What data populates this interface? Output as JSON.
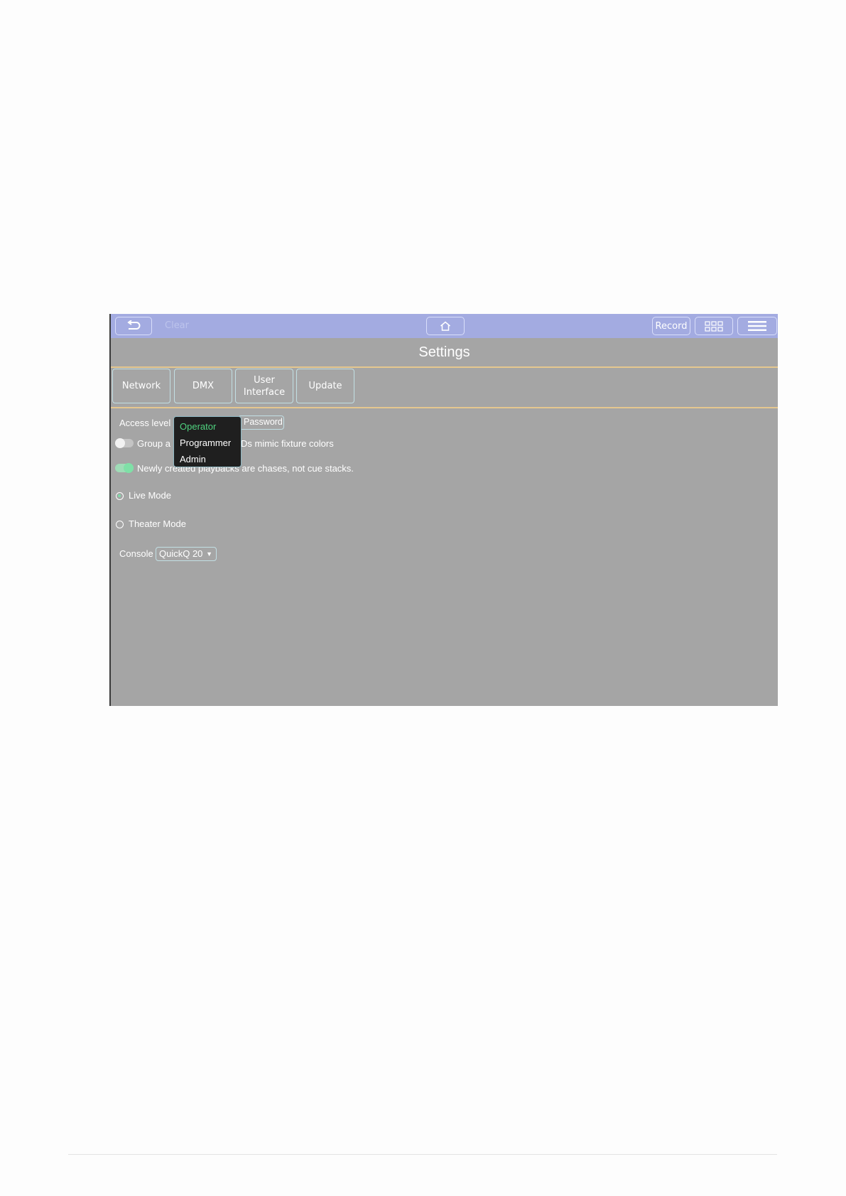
{
  "toolbar": {
    "clear_label": "Clear",
    "record_label": "Record"
  },
  "page": {
    "title": "Settings"
  },
  "tabs": [
    {
      "label": "Network"
    },
    {
      "label": "DMX"
    },
    {
      "label": "User Interface"
    },
    {
      "label": "Update"
    }
  ],
  "access": {
    "label": "Access level",
    "password_label": "Password",
    "options": [
      "Operator",
      "Programmer",
      "Admin"
    ],
    "selected": "Operator"
  },
  "options": {
    "group_leds_prefix": "Group a",
    "group_leds_suffix": "Ds mimic fixture colors",
    "group_leds_enabled": false,
    "chases_label": "Newly created playbacks are chases, not cue stacks.",
    "chases_enabled": true
  },
  "modes": {
    "live_label": "Live Mode",
    "theater_label": "Theater Mode",
    "selected": "live"
  },
  "console": {
    "label": "Console",
    "value": "QuickQ 20"
  },
  "colors": {
    "topbar": "#a3abe1",
    "screen": "#a5a5a5",
    "accent_green": "#4fd37f",
    "divider": "#e5c78f"
  }
}
